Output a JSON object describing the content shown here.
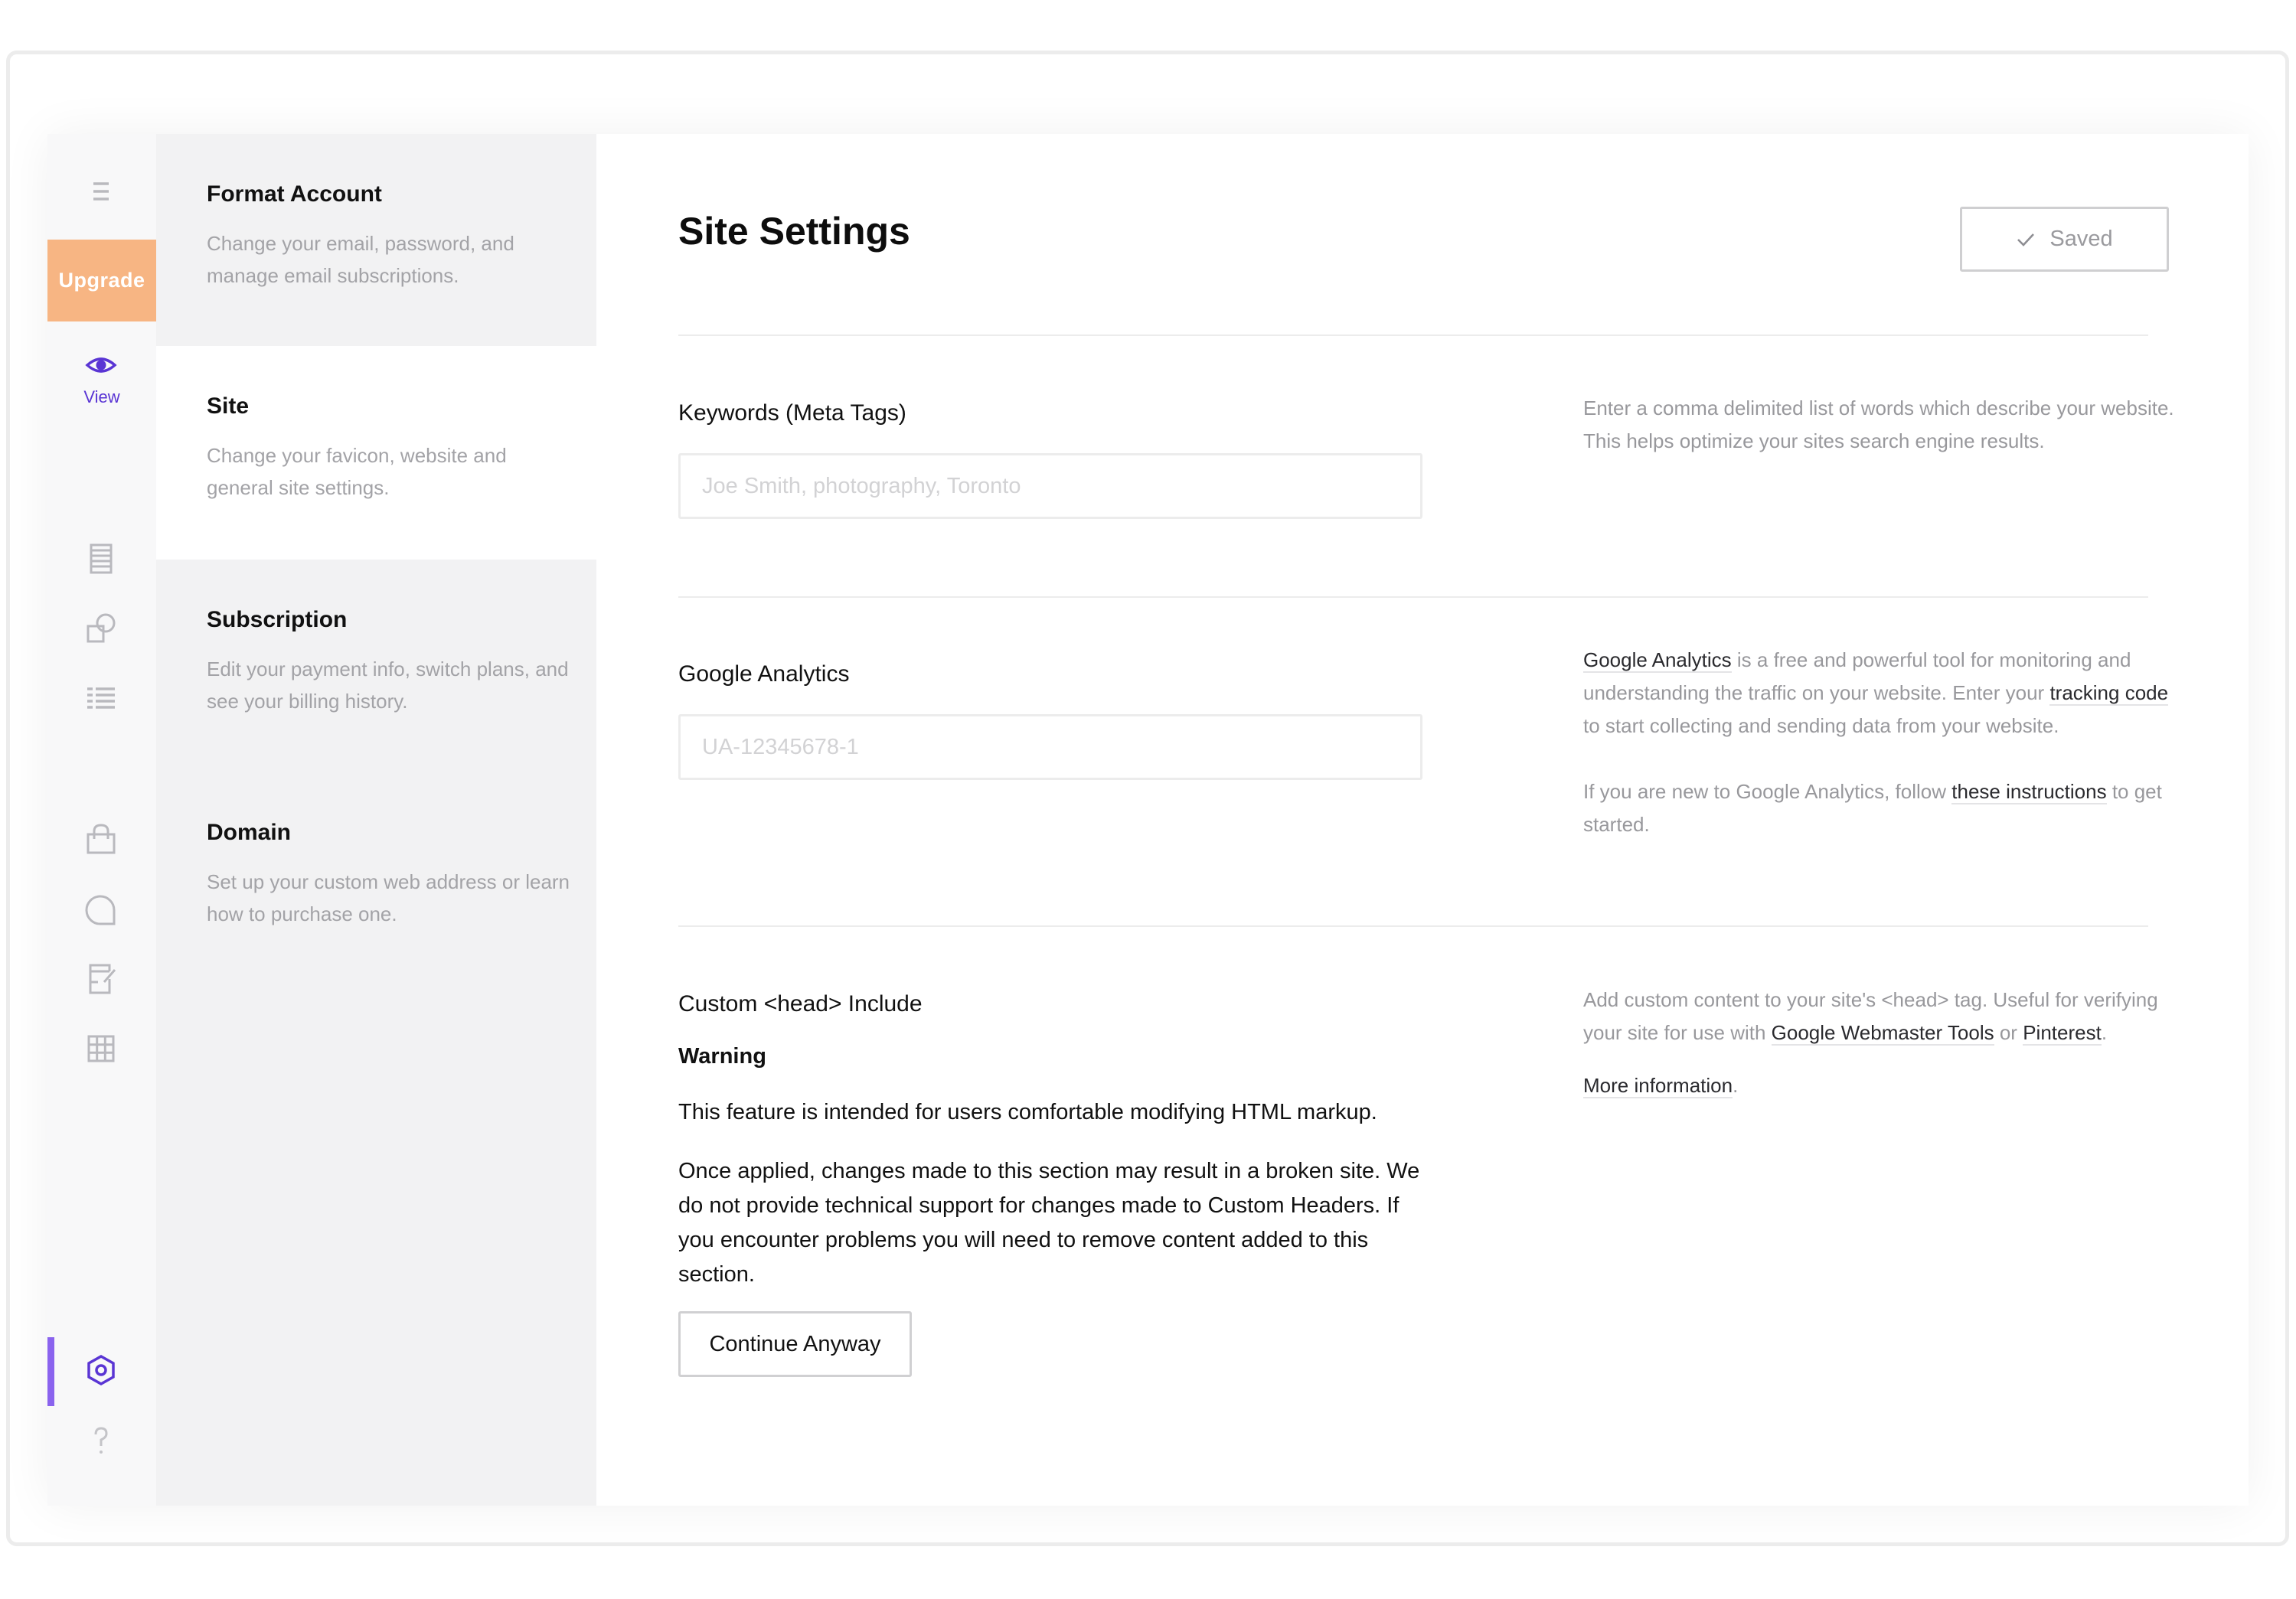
{
  "window": {
    "controls": [
      "close",
      "minimize",
      "maximize"
    ]
  },
  "rail": {
    "menu_icon": "menu-icon",
    "upgrade_label": "Upgrade",
    "view_label": "View",
    "icons": [
      "pages-icon",
      "design-icon",
      "list-icon",
      "store-icon",
      "chat-icon",
      "blog-icon",
      "grid-icon",
      "settings-icon",
      "help-icon"
    ],
    "accent_color": "#8a63ee",
    "upgrade_color": "#f7b583",
    "active_color": "#5a35d4"
  },
  "settings_list": {
    "items": [
      {
        "title": "Format Account",
        "description": "Change your email, password, and manage email subscriptions.",
        "active": false
      },
      {
        "title": "Site",
        "description": "Change your favicon, website and general site settings.",
        "active": true
      },
      {
        "title": "Subscription",
        "description": "Edit your payment info, switch plans, and see your billing history.",
        "active": false
      },
      {
        "title": "Domain",
        "description": "Set up your custom web address or learn how to purchase one.",
        "active": false
      }
    ]
  },
  "main": {
    "title": "Site Settings",
    "saved_label": "Saved",
    "keywords": {
      "label": "Keywords (Meta Tags)",
      "value": "",
      "placeholder": "Joe Smith, photography, Toronto",
      "help": "Enter a comma delimited list of words which describe your website. This helps optimize your sites search engine results."
    },
    "analytics": {
      "label": "Google Analytics",
      "value": "",
      "placeholder": "UA-12345678-1",
      "help_link1": "Google Analytics",
      "help_text1": " is a free and powerful tool for monitoring and understanding the traffic on your website. Enter your ",
      "help_link2": "tracking code",
      "help_text2": " to start collecting and sending data from your website.",
      "help2_text1": "If you are new to Google Analytics, follow ",
      "help2_link": "these instructions",
      "help2_text2": " to get started."
    },
    "custom_head": {
      "label": "Custom <head> Include",
      "warning_title": "Warning",
      "warning_p1": "This feature is intended for users comfortable modifying HTML markup.",
      "warning_p2": "Once applied, changes made to this section may result in a broken site. We do not provide technical support for changes made to Custom Headers. If you encounter problems you will need to remove content added to this section.",
      "continue_label": "Continue Anyway",
      "help_text1": "Add custom content to your site's <head> tag. Useful for verifying your site for use with ",
      "help_link1": "Google Webmaster Tools",
      "help_or": " or ",
      "help_link2": "Pinterest",
      "help_period": ".",
      "more_info_link": "More information",
      "more_info_period": "."
    }
  }
}
